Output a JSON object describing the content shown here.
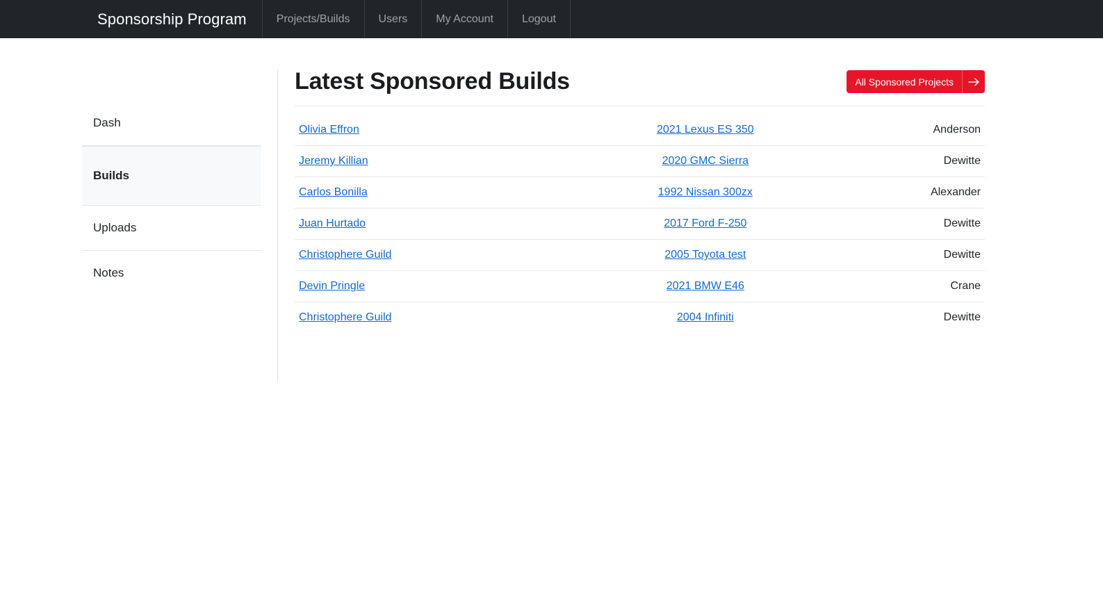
{
  "navbar": {
    "brand": "Sponsorship Program",
    "links": [
      {
        "label": "Projects/Builds"
      },
      {
        "label": "Users"
      },
      {
        "label": "My Account"
      },
      {
        "label": "Logout"
      }
    ],
    "background_color": "#212529",
    "brand_color": "#ffffff",
    "link_color": "#9da3a9"
  },
  "sidebar": {
    "items": [
      {
        "label": "Dash",
        "active": false
      },
      {
        "label": "Builds",
        "active": true
      },
      {
        "label": "Uploads",
        "active": false
      },
      {
        "label": "Notes",
        "active": false
      }
    ],
    "active_background": "#f8f9fa"
  },
  "main": {
    "title": "Latest Sponsored Builds",
    "action_button": {
      "label": "All Sponsored Projects",
      "icon": "arrow-right-icon",
      "color": "#e8152a",
      "text_color": "#ffffff"
    },
    "table": {
      "link_color": "#1268d3",
      "rows": [
        {
          "sponsor": "Olivia Effron",
          "build": "2021 Lexus ES 350",
          "owner": "Anderson"
        },
        {
          "sponsor": "Jeremy Killian",
          "build": "2020 GMC Sierra",
          "owner": "Dewitte"
        },
        {
          "sponsor": "Carlos Bonilla",
          "build": "1992 Nissan 300zx",
          "owner": "Alexander"
        },
        {
          "sponsor": "Juan Hurtado",
          "build": "2017 Ford F-250",
          "owner": "Dewitte"
        },
        {
          "sponsor": "Christophere Guild",
          "build": "2005 Toyota test",
          "owner": "Dewitte"
        },
        {
          "sponsor": "Devin Pringle",
          "build": "2021 BMW E46",
          "owner": "Crane"
        },
        {
          "sponsor": "Christophere Guild",
          "build": "2004 Infiniti",
          "owner": "Dewitte"
        }
      ]
    }
  }
}
